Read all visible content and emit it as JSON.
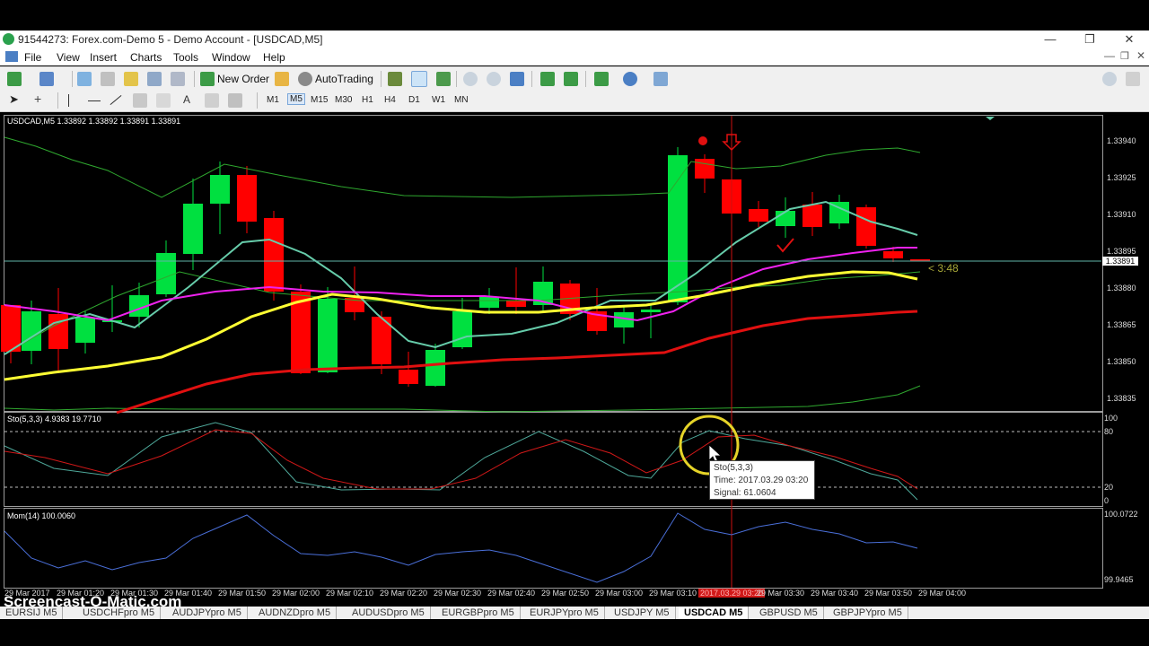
{
  "window": {
    "title": "91544273: Forex.com-Demo 5 - Demo Account - [USDCAD,M5]"
  },
  "menu": [
    "File",
    "View",
    "Insert",
    "Charts",
    "Tools",
    "Window",
    "Help"
  ],
  "toolbar": {
    "new_order": "New Order",
    "autotrading": "AutoTrading"
  },
  "timeframes": [
    "M1",
    "M5",
    "M15",
    "M30",
    "H1",
    "H4",
    "D1",
    "W1",
    "MN"
  ],
  "selected_timeframe": "M5",
  "main_chart": {
    "header": "USDCAD,M5  1.33892 1.33892 1.33891 1.33891",
    "price_labels": [
      "1.33940",
      "1.33925",
      "1.33910",
      "1.33895",
      "1.33880",
      "1.33865",
      "1.33850",
      "1.33835"
    ],
    "current_price": "1.33891",
    "countdown": "< 3:48"
  },
  "stoch": {
    "header": "Sto(5,3,3) 4.9383 19.7710",
    "levels": [
      "100",
      "80",
      "20",
      "0"
    ],
    "tooltip": {
      "line1": "Sto(5,3,3)",
      "line2": "Time: 2017.03.29 03:20",
      "line3": "Signal: 61.0604"
    }
  },
  "momentum": {
    "header": "Mom(14) 100.0060",
    "levels": [
      "100.0722",
      "99.9465"
    ]
  },
  "time_labels": [
    "29 Mar 2017",
    "29 Mar 01:20",
    "29 Mar 01:30",
    "29 Mar 01:40",
    "29 Mar 01:50",
    "29 Mar 02:00",
    "29 Mar 02:10",
    "29 Mar 02:20",
    "29 Mar 02:30",
    "29 Mar 02:40",
    "29 Mar 02:50",
    "29 Mar 03:00",
    "29 Mar 03:10",
    "2017.03.29 03:20",
    "29 Mar 03:30",
    "29 Mar 03:40",
    "29 Mar 03:50",
    "29 Mar 04:00"
  ],
  "symbol_tabs": [
    "EURSIJ M5",
    "USDCHFpro M5",
    "AUDJPYpro M5",
    "AUDNZDpro M5",
    "AUDUSDpro M5",
    "EURGBPpro M5",
    "EURJPYpro M5",
    "USDJPY M5",
    "USDCAD M5",
    "GBPUSD M5",
    "GBPJPYpro M5"
  ],
  "active_tab": "USDCAD M5",
  "watermark": "Screencast-O-Matic.com",
  "colors": {
    "bull": "#00e040",
    "bear": "#ff0000",
    "bb": "#2fa82f",
    "ma_cyan": "#66ccaa",
    "ma_magenta": "#ee22ee",
    "ma_yellow": "#ffff33",
    "ma_red": "#e01010",
    "stoch_main": "#4ea89a",
    "stoch_signal": "#d01818",
    "mom": "#4a6fd9"
  }
}
